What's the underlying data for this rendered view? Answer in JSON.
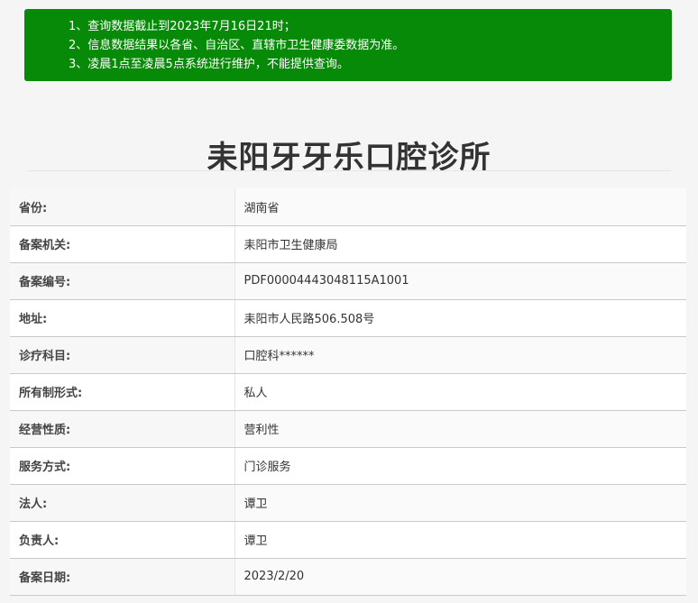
{
  "notice": {
    "lines": [
      "1、查询数据截止到2023年7月16日21时；",
      "2、信息数据结果以各省、自治区、直辖市卫生健康委数据为准。",
      "3、凌晨1点至凌晨5点系统进行维护，不能提供查询。"
    ],
    "background": "#088a09"
  },
  "clinic": {
    "name": "耒阳牙牙乐口腔诊所"
  },
  "details": [
    {
      "label": "省份:",
      "value": "湖南省"
    },
    {
      "label": "备案机关:",
      "value": "耒阳市卫生健康局"
    },
    {
      "label": "备案编号:",
      "value": "PDF00004443048115A1001"
    },
    {
      "label": "地址:",
      "value": "耒阳市人民路506.508号"
    },
    {
      "label": "诊疗科目:",
      "value": "口腔科******"
    },
    {
      "label": "所有制形式:",
      "value": "私人"
    },
    {
      "label": "经营性质:",
      "value": "营利性"
    },
    {
      "label": "服务方式:",
      "value": "门诊服务"
    },
    {
      "label": "法人:",
      "value": "谭卫"
    },
    {
      "label": "负责人:",
      "value": "谭卫"
    },
    {
      "label": "备案日期:",
      "value": "2023/2/20"
    }
  ]
}
